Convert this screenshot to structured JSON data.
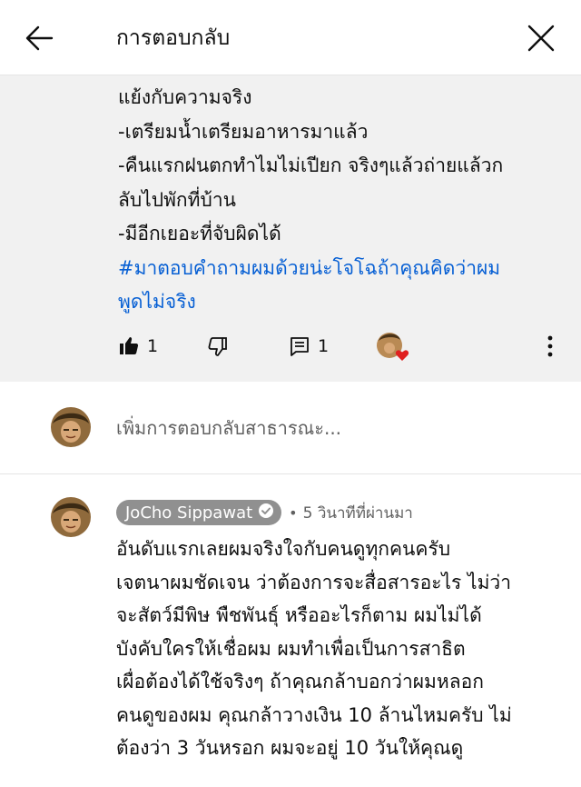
{
  "header": {
    "title": "การตอบกลับ"
  },
  "parent_comment": {
    "lines": [
      "แย้งกับความจริง",
      "-เตรียมน้ำเตรียมอาหารมาแล้ว",
      "-คืนแรกฝนตกทำไมไม่เปียก จริงๆแล้วถ่ายแล้วก",
      "ลับไปพักที่บ้าน",
      "-มีอีกเยอะที่จับผิดได้"
    ],
    "hashtag_lines": [
      "#มาตอบคำถามผมด้วยน่ะโจโฉถ้าคุณคิดว่าผม",
      "พูดไม่จริง"
    ],
    "like_count": "1",
    "reply_count": "1"
  },
  "add_reply": {
    "placeholder": "เพิ่มการตอบกลับสาธารณะ..."
  },
  "reply": {
    "author": "JoCho Sippawat",
    "time": "5 วินาทีที่ผ่านมา",
    "lines": [
      "อันดับแรกเลยผมจริงใจกับคนดูทุกคนครับ",
      "เจตนาผมชัดเจน ว่าต้องการจะสื่อสารอะไร ไม่ว่า",
      "จะสัตว์มีพิษ พืชพันธุ์ หรืออะไรก็ตาม  ผมไม่ได้",
      "บังคับใครให้เชื่อผม ผมทำเพื่อเป็นการสาธิต",
      "เผื่อต้องได้ใช้จริงๆ ถ้าคุณกล้าบอกว่าผมหลอก",
      "คนดูของผม คุณกล้าวางเงิน 10 ล้านไหมครับ ไม่",
      "ต้องว่า 3 วันหรอก ผมจะอยู่ 10 วันให้คุณดู"
    ]
  },
  "colors": {
    "accent_link": "#065fd4",
    "heart": "#e02020",
    "chip": "#909090"
  }
}
